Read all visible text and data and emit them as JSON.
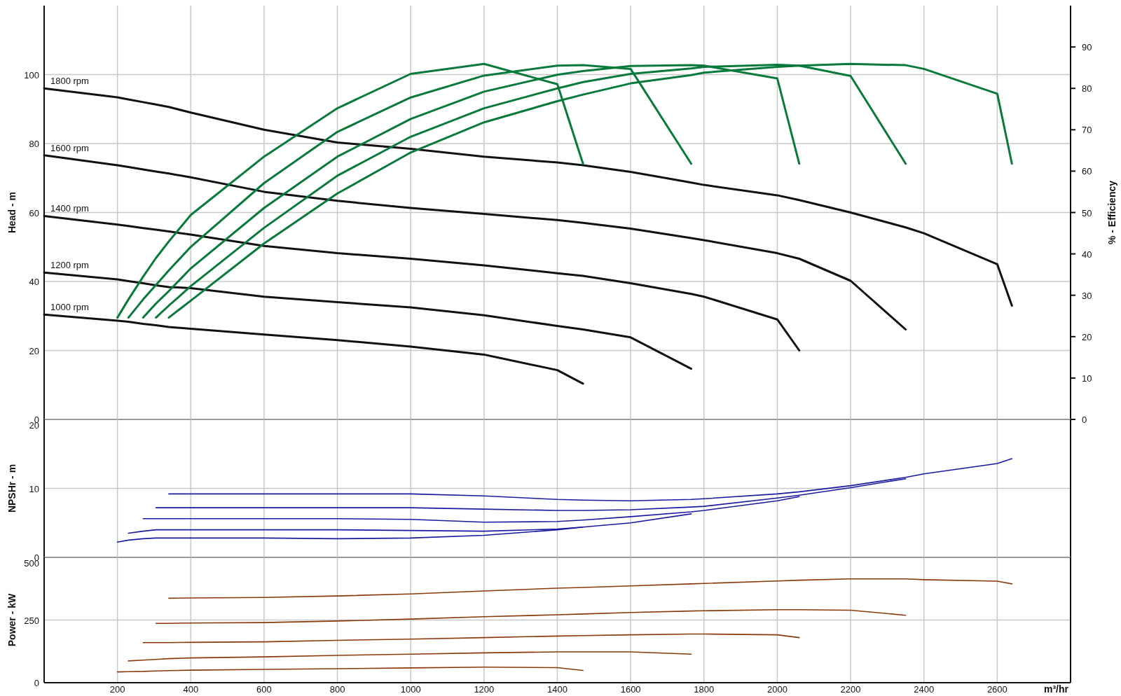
{
  "charts": [
    {
      "chart_data": {
        "type": "line",
        "ylabel": "Head - m",
        "x": [
          0,
          200,
          230,
          270,
          305,
          340,
          400,
          600,
          800,
          1000,
          1200,
          1400,
          1470,
          1600,
          1765,
          1800,
          2000,
          2060,
          2200,
          2350,
          2400,
          2600,
          2640
        ],
        "xlim": [
          0,
          2800
        ],
        "ylim": [
          0,
          120
        ],
        "yticks": [
          0,
          20,
          40,
          60,
          80,
          100
        ],
        "grid": true,
        "series": [
          {
            "name": "1800 rpm",
            "color": "#111111",
            "values": [
              96,
              93.4,
              92.8,
              92,
              91.3,
              90.6,
              89,
              84,
              80.3,
              78.5,
              76.2,
              74.5,
              73.7,
              71.8,
              68.7,
              68,
              65,
              63.6,
              60,
              55.7,
              54,
              45,
              33
            ]
          },
          {
            "name": "1600 rpm",
            "color": "#111111",
            "values": [
              76.6,
              73.7,
              73.2,
              72.5,
              71.9,
              71.3,
              70.2,
              66,
              63.4,
              61.3,
              59.6,
              57.8,
              57,
              55.3,
              52.6,
              52,
              48.2,
              46.6,
              40.2,
              26.1,
              null,
              null,
              null
            ]
          },
          {
            "name": "1400 rpm",
            "color": "#111111",
            "values": [
              59,
              56.5,
              56.1,
              55.5,
              55,
              54.5,
              53.6,
              50.3,
              48.2,
              46.6,
              44.7,
              42.4,
              41.6,
              39.5,
              36.4,
              35.6,
              29,
              20,
              null,
              null,
              null,
              null,
              null
            ]
          },
          {
            "name": "1200 rpm",
            "color": "#111111",
            "values": [
              42.6,
              40.6,
              40.1,
              39.5,
              38.9,
              38.4,
              38.1,
              35.6,
              34,
              32.5,
              30.2,
              27.1,
              26.1,
              23.8,
              14.7,
              null,
              null,
              null,
              null,
              null,
              null,
              null,
              null
            ]
          },
          {
            "name": "1000 rpm",
            "color": "#111111",
            "values": [
              30.4,
              28.6,
              28.3,
              27.7,
              27.3,
              26.8,
              26.3,
              24.6,
              23,
              21.1,
              18.8,
              14.3,
              10.4,
              null,
              null,
              null,
              null,
              null,
              null,
              null,
              null,
              null,
              null
            ]
          }
        ]
      }
    },
    {
      "chart_data": {
        "type": "line",
        "ylabel": "% - Efficiency",
        "x": [
          200,
          230,
          270,
          305,
          340,
          400,
          600,
          800,
          1000,
          1200,
          1400,
          1470,
          1600,
          1765,
          1800,
          2000,
          2060,
          2200,
          2350,
          2400,
          2600,
          2640
        ],
        "xlim": [
          0,
          2800
        ],
        "ylim": [
          0,
          100
        ],
        "yticks": [
          0,
          10,
          20,
          30,
          40,
          50,
          60,
          70,
          80,
          90
        ],
        "series": [
          {
            "color": "#0a7a3c",
            "values": [
              24.6,
              29,
              34.5,
              39,
              43,
              49.4,
              63.5,
              75.2,
              83.5,
              85.9,
              81,
              61.8,
              null,
              null,
              null,
              null,
              null,
              null,
              null,
              null,
              null,
              null
            ]
          },
          {
            "color": "#0a7a3c",
            "values": [
              null,
              24.6,
              29,
              32.5,
              36,
              41.7,
              57.1,
              69.5,
              77.8,
              83.1,
              85.5,
              85.6,
              84.7,
              61.8,
              null,
              null,
              null,
              null,
              null,
              null,
              null,
              null
            ]
          },
          {
            "color": "#0a7a3c",
            "values": [
              null,
              null,
              24.6,
              28,
              31,
              36.5,
              51.1,
              63.5,
              72.6,
              79.2,
              83.3,
              84.2,
              85.4,
              85.6,
              85.5,
              82.4,
              61.8,
              null,
              null,
              null,
              null,
              null
            ]
          },
          {
            "color": "#0a7a3c",
            "values": [
              null,
              null,
              null,
              24.6,
              27.5,
              32.2,
              46.3,
              58.9,
              68.3,
              75.2,
              80,
              81.5,
              83.5,
              84.8,
              85.2,
              85.7,
              85.5,
              83,
              61.8,
              null,
              null,
              null
            ]
          },
          {
            "color": "#0a7a3c",
            "values": [
              null,
              null,
              null,
              null,
              24.6,
              28.7,
              42.5,
              54.6,
              64.5,
              71.8,
              76.9,
              78.5,
              81.2,
              83.2,
              83.8,
              85.2,
              85.5,
              85.9,
              85.6,
              84.7,
              78.7,
              61.8
            ]
          }
        ]
      }
    },
    {
      "chart_data": {
        "type": "line",
        "ylabel": "NPSHr - m",
        "x": [
          200,
          230,
          270,
          305,
          340,
          400,
          600,
          800,
          1000,
          1200,
          1400,
          1470,
          1600,
          1765,
          1800,
          2000,
          2060,
          2200,
          2350,
          2400,
          2600,
          2640
        ],
        "xlim": [
          0,
          2800
        ],
        "ylim": [
          0,
          20
        ],
        "yticks": [
          0,
          10,
          20
        ],
        "grid": true,
        "series": [
          {
            "color": "#1a1aa0",
            "values": [
              2.2,
              2.5,
              2.7,
              2.8,
              2.8,
              2.8,
              2.8,
              2.7,
              2.8,
              3.2,
              4.0,
              4.4,
              null,
              null,
              null,
              null,
              null,
              null,
              null,
              null,
              null,
              null
            ]
          },
          {
            "color": "#1a1aa0",
            "values": [
              null,
              3.5,
              3.8,
              4.0,
              4.0,
              4.0,
              4.0,
              4.0,
              3.9,
              3.8,
              4.1,
              4.4,
              5.0,
              6.3,
              null,
              null,
              null,
              null,
              null,
              null,
              null,
              null
            ]
          },
          {
            "color": "#1a1aa0",
            "values": [
              null,
              null,
              5.6,
              5.6,
              5.6,
              5.6,
              5.6,
              5.6,
              5.5,
              5.1,
              5.2,
              5.4,
              5.9,
              6.6,
              6.8,
              8.2,
              8.8,
              null,
              null,
              null,
              null,
              null
            ]
          },
          {
            "color": "#1a1aa0",
            "values": [
              null,
              null,
              null,
              7.2,
              7.2,
              7.2,
              7.2,
              7.2,
              7.2,
              7.0,
              6.8,
              6.8,
              6.9,
              7.3,
              7.4,
              8.6,
              9.0,
              10.1,
              11.4,
              null,
              null,
              null
            ]
          },
          {
            "color": "#1a1aa0",
            "values": [
              null,
              null,
              null,
              null,
              9.2,
              9.2,
              9.2,
              9.2,
              9.2,
              8.9,
              8.4,
              8.3,
              8.2,
              8.4,
              8.5,
              9.2,
              9.5,
              10.4,
              11.6,
              12.1,
              13.6,
              14.3
            ]
          }
        ]
      }
    },
    {
      "chart_data": {
        "type": "line",
        "ylabel": "Power - kW",
        "xlabel": "m³/hr",
        "x": [
          200,
          230,
          270,
          305,
          340,
          400,
          600,
          800,
          1000,
          1200,
          1400,
          1470,
          1600,
          1765,
          1800,
          2000,
          2060,
          2200,
          2350,
          2400,
          2600,
          2640
        ],
        "xlim": [
          0,
          2800
        ],
        "ylim": [
          0,
          500
        ],
        "xticks": [
          200,
          400,
          600,
          800,
          1000,
          1200,
          1400,
          1600,
          1800,
          2000,
          2200,
          2400,
          2600
        ],
        "yticks": [
          0,
          250,
          500
        ],
        "grid": true,
        "series": [
          {
            "color": "#8a3a0a",
            "values": [
              43,
              44,
              45,
              47,
              48,
              50,
              53,
              56,
              59,
              62,
              60,
              49,
              null,
              null,
              null,
              null,
              null,
              null,
              null,
              null,
              null,
              null
            ]
          },
          {
            "color": "#8a3a0a",
            "values": [
              null,
              87,
              90,
              93,
              96,
              99,
              103,
              109,
              114,
              119,
              123,
              123,
              123,
              114,
              null,
              null,
              null,
              null,
              null,
              null,
              null,
              null
            ]
          },
          {
            "color": "#8a3a0a",
            "values": [
              null,
              null,
              160,
              160,
              160,
              161,
              163,
              169,
              174,
              180,
              186,
              188,
              191,
              194,
              194,
              191,
              180,
              null,
              null,
              null,
              null,
              null
            ]
          },
          {
            "color": "#8a3a0a",
            "values": [
              null,
              null,
              null,
              237,
              237,
              238,
              240,
              246,
              254,
              263,
              271,
              274,
              280,
              286,
              287,
              291,
              291,
              289,
              269,
              null,
              null,
              null
            ]
          },
          {
            "color": "#8a3a0a",
            "values": [
              null,
              null,
              null,
              null,
              337,
              338,
              340,
              346,
              354,
              366,
              377,
              380,
              386,
              394,
              396,
              406,
              409,
              414,
              414,
              411,
              405,
              394
            ]
          }
        ]
      }
    }
  ]
}
